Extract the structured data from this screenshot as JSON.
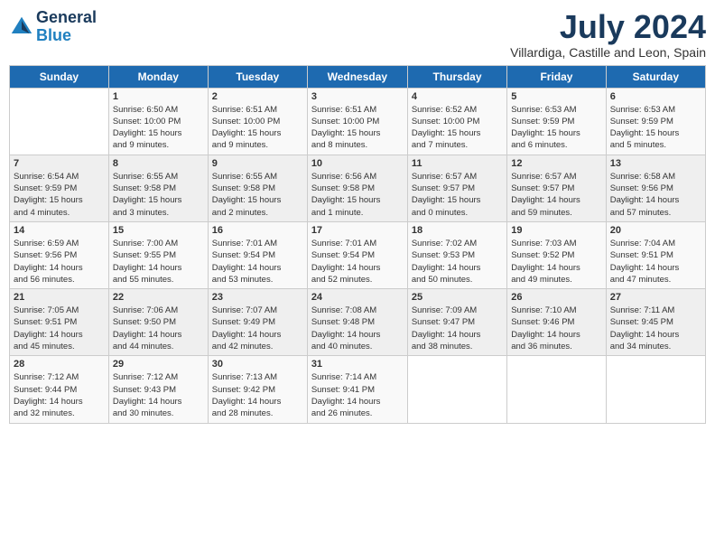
{
  "logo": {
    "line1": "General",
    "line2": "Blue"
  },
  "title": "July 2024",
  "subtitle": "Villardiga, Castille and Leon, Spain",
  "headers": [
    "Sunday",
    "Monday",
    "Tuesday",
    "Wednesday",
    "Thursday",
    "Friday",
    "Saturday"
  ],
  "weeks": [
    [
      {
        "day": "",
        "info": ""
      },
      {
        "day": "1",
        "info": "Sunrise: 6:50 AM\nSunset: 10:00 PM\nDaylight: 15 hours\nand 9 minutes."
      },
      {
        "day": "2",
        "info": "Sunrise: 6:51 AM\nSunset: 10:00 PM\nDaylight: 15 hours\nand 9 minutes."
      },
      {
        "day": "3",
        "info": "Sunrise: 6:51 AM\nSunset: 10:00 PM\nDaylight: 15 hours\nand 8 minutes."
      },
      {
        "day": "4",
        "info": "Sunrise: 6:52 AM\nSunset: 10:00 PM\nDaylight: 15 hours\nand 7 minutes."
      },
      {
        "day": "5",
        "info": "Sunrise: 6:53 AM\nSunset: 9:59 PM\nDaylight: 15 hours\nand 6 minutes."
      },
      {
        "day": "6",
        "info": "Sunrise: 6:53 AM\nSunset: 9:59 PM\nDaylight: 15 hours\nand 5 minutes."
      }
    ],
    [
      {
        "day": "7",
        "info": "Sunrise: 6:54 AM\nSunset: 9:59 PM\nDaylight: 15 hours\nand 4 minutes."
      },
      {
        "day": "8",
        "info": "Sunrise: 6:55 AM\nSunset: 9:58 PM\nDaylight: 15 hours\nand 3 minutes."
      },
      {
        "day": "9",
        "info": "Sunrise: 6:55 AM\nSunset: 9:58 PM\nDaylight: 15 hours\nand 2 minutes."
      },
      {
        "day": "10",
        "info": "Sunrise: 6:56 AM\nSunset: 9:58 PM\nDaylight: 15 hours\nand 1 minute."
      },
      {
        "day": "11",
        "info": "Sunrise: 6:57 AM\nSunset: 9:57 PM\nDaylight: 15 hours\nand 0 minutes."
      },
      {
        "day": "12",
        "info": "Sunrise: 6:57 AM\nSunset: 9:57 PM\nDaylight: 14 hours\nand 59 minutes."
      },
      {
        "day": "13",
        "info": "Sunrise: 6:58 AM\nSunset: 9:56 PM\nDaylight: 14 hours\nand 57 minutes."
      }
    ],
    [
      {
        "day": "14",
        "info": "Sunrise: 6:59 AM\nSunset: 9:56 PM\nDaylight: 14 hours\nand 56 minutes."
      },
      {
        "day": "15",
        "info": "Sunrise: 7:00 AM\nSunset: 9:55 PM\nDaylight: 14 hours\nand 55 minutes."
      },
      {
        "day": "16",
        "info": "Sunrise: 7:01 AM\nSunset: 9:54 PM\nDaylight: 14 hours\nand 53 minutes."
      },
      {
        "day": "17",
        "info": "Sunrise: 7:01 AM\nSunset: 9:54 PM\nDaylight: 14 hours\nand 52 minutes."
      },
      {
        "day": "18",
        "info": "Sunrise: 7:02 AM\nSunset: 9:53 PM\nDaylight: 14 hours\nand 50 minutes."
      },
      {
        "day": "19",
        "info": "Sunrise: 7:03 AM\nSunset: 9:52 PM\nDaylight: 14 hours\nand 49 minutes."
      },
      {
        "day": "20",
        "info": "Sunrise: 7:04 AM\nSunset: 9:51 PM\nDaylight: 14 hours\nand 47 minutes."
      }
    ],
    [
      {
        "day": "21",
        "info": "Sunrise: 7:05 AM\nSunset: 9:51 PM\nDaylight: 14 hours\nand 45 minutes."
      },
      {
        "day": "22",
        "info": "Sunrise: 7:06 AM\nSunset: 9:50 PM\nDaylight: 14 hours\nand 44 minutes."
      },
      {
        "day": "23",
        "info": "Sunrise: 7:07 AM\nSunset: 9:49 PM\nDaylight: 14 hours\nand 42 minutes."
      },
      {
        "day": "24",
        "info": "Sunrise: 7:08 AM\nSunset: 9:48 PM\nDaylight: 14 hours\nand 40 minutes."
      },
      {
        "day": "25",
        "info": "Sunrise: 7:09 AM\nSunset: 9:47 PM\nDaylight: 14 hours\nand 38 minutes."
      },
      {
        "day": "26",
        "info": "Sunrise: 7:10 AM\nSunset: 9:46 PM\nDaylight: 14 hours\nand 36 minutes."
      },
      {
        "day": "27",
        "info": "Sunrise: 7:11 AM\nSunset: 9:45 PM\nDaylight: 14 hours\nand 34 minutes."
      }
    ],
    [
      {
        "day": "28",
        "info": "Sunrise: 7:12 AM\nSunset: 9:44 PM\nDaylight: 14 hours\nand 32 minutes."
      },
      {
        "day": "29",
        "info": "Sunrise: 7:12 AM\nSunset: 9:43 PM\nDaylight: 14 hours\nand 30 minutes."
      },
      {
        "day": "30",
        "info": "Sunrise: 7:13 AM\nSunset: 9:42 PM\nDaylight: 14 hours\nand 28 minutes."
      },
      {
        "day": "31",
        "info": "Sunrise: 7:14 AM\nSunset: 9:41 PM\nDaylight: 14 hours\nand 26 minutes."
      },
      {
        "day": "",
        "info": ""
      },
      {
        "day": "",
        "info": ""
      },
      {
        "day": "",
        "info": ""
      }
    ]
  ]
}
